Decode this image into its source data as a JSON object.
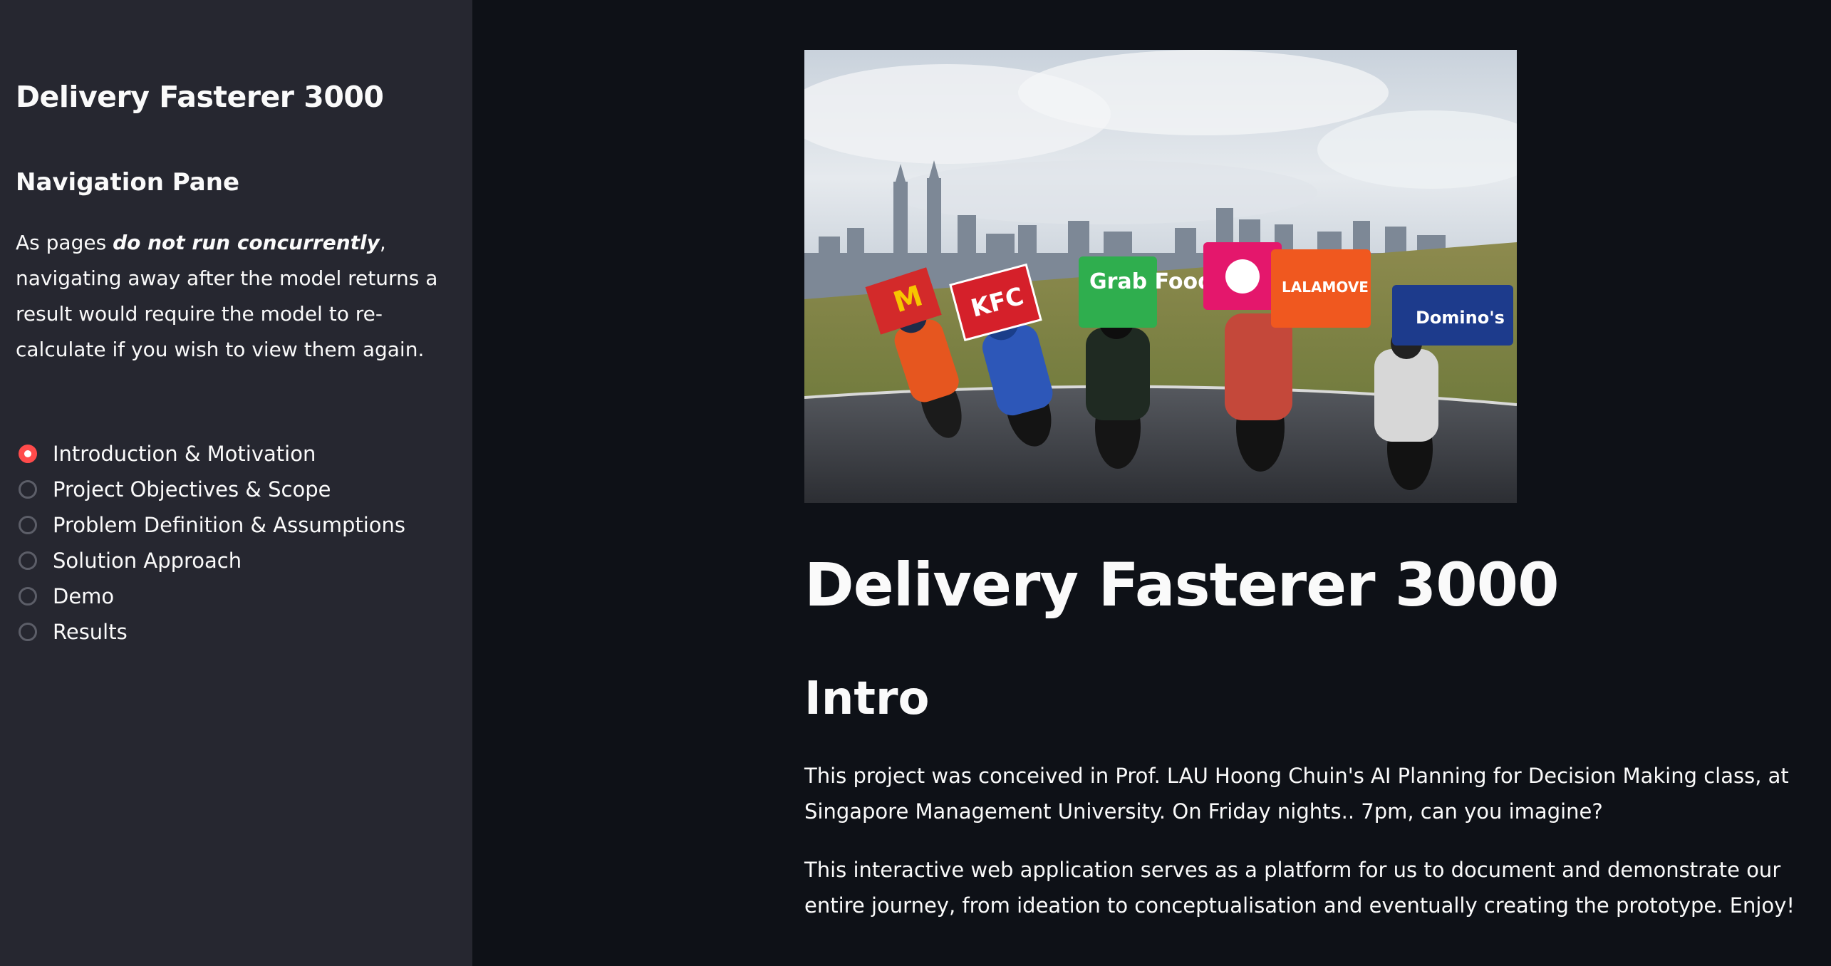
{
  "sidebar": {
    "title": "Delivery Fasterer 3000",
    "subtitle": "Navigation Pane",
    "note": {
      "prefix": "As pages ",
      "emphasis": "do not run concurrently",
      "suffix": ", navigating away after the model returns a result would require the model to re-calculate if you wish to view them again."
    },
    "nav": {
      "selected_index": 0,
      "options": [
        "Introduction & Motivation",
        "Project Objectives & Scope",
        "Problem Definition & Assumptions",
        "Solution Approach",
        "Demo",
        "Results"
      ]
    }
  },
  "main": {
    "hero_image": {
      "signs": [
        "KFC",
        "Grab Food",
        "LALAMOVE",
        "Domino's"
      ]
    },
    "title": "Delivery Fasterer 3000",
    "section_title": "Intro",
    "paragraphs": [
      "This project was conceived in Prof. LAU Hoong Chuin's AI Planning for Decision Making class, at Singapore Management University. On Friday nights.. 7pm, can you imagine?",
      "This interactive web application serves as a platform for us to document and demonstrate our entire journey, from ideation to conceptualisation and eventually creating the prototype. Enjoy!"
    ]
  },
  "colors": {
    "sidebar_bg": "#262730",
    "main_bg": "#0e1117",
    "accent": "#ff4b4b",
    "text": "#fafafa"
  }
}
